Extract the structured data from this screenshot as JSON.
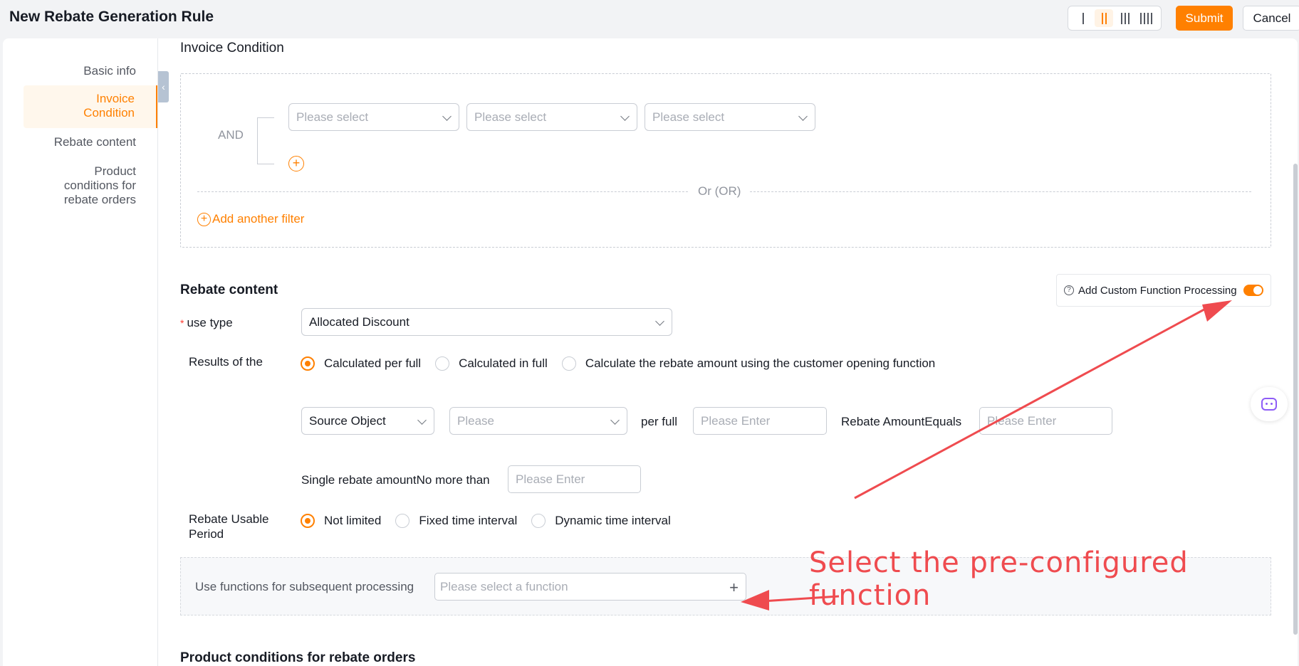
{
  "header": {
    "title": "New Rebate Generation Rule",
    "submit_label": "Submit",
    "cancel_label": "Cancel",
    "layout_options": [
      "1-column",
      "2-column",
      "3-column",
      "4-column"
    ],
    "active_layout": "2-column"
  },
  "sidebar": {
    "items": [
      {
        "label": "Basic info",
        "active": false
      },
      {
        "label": "Invoice Condition",
        "active": true
      },
      {
        "label": "Rebate content",
        "active": false
      },
      {
        "label": "Product conditions for rebate orders",
        "active": false
      }
    ]
  },
  "invoice_condition": {
    "title": "Invoice Condition",
    "and_label": "AND",
    "selects": [
      "Please select",
      "Please select",
      "Please select"
    ],
    "or_label": "Or (OR)",
    "add_filter_label": "Add another filter"
  },
  "rebate_content": {
    "title": "Rebate content",
    "custom_function_label": "Add Custom Function Processing",
    "custom_function_enabled": true,
    "use_type_label": "use type",
    "use_type_value": "Allocated Discount",
    "results_label": "Results of the",
    "results_options": [
      {
        "label": "Calculated per full",
        "selected": true
      },
      {
        "label": "Calculated in full",
        "selected": false
      },
      {
        "label": "Calculate the rebate amount using the customer opening function",
        "selected": false
      }
    ],
    "source_object_value": "Source Object",
    "please_placeholder": "Please",
    "per_full_label": "per full",
    "please_enter_placeholder": "Please Enter",
    "rebate_amount_equals_label": "Rebate AmountEquals",
    "single_rebate_label": "Single rebate amountNo more than",
    "usable_period_label": "Rebate Usable Period",
    "usable_period_options": [
      {
        "label": "Not limited",
        "selected": true
      },
      {
        "label": "Fixed time interval",
        "selected": false
      },
      {
        "label": "Dynamic time interval",
        "selected": false
      }
    ],
    "subsequent_processing_label": "Use functions for subsequent processing",
    "function_placeholder": "Please select a function"
  },
  "product_conditions": {
    "title": "Product conditions for rebate orders"
  },
  "annotation": {
    "text": "Select the pre-configured function",
    "color": "#ef4b4f"
  },
  "colors": {
    "accent": "#ff8000",
    "active_nav_bg": "#fff7ec"
  }
}
